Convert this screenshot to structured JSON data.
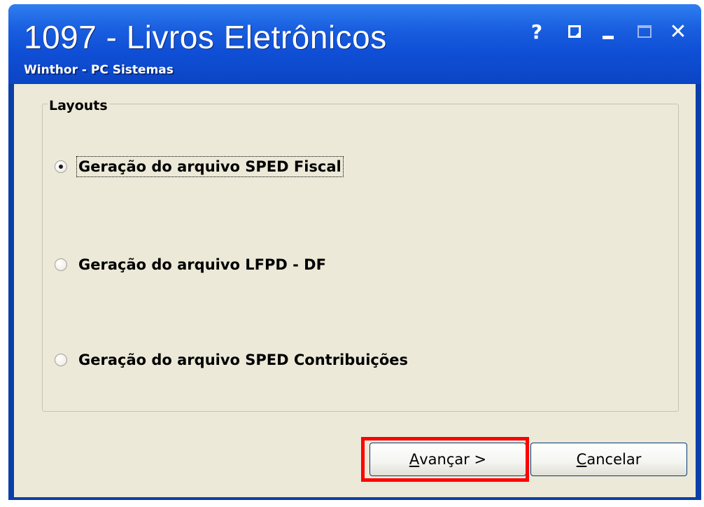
{
  "window": {
    "title": "1097 - Livros Eletrônicos",
    "subtitle": "Winthor - PC Sistemas",
    "controls": {
      "help": "?",
      "close": "✕"
    }
  },
  "layouts": {
    "group_label": "Layouts",
    "options": [
      {
        "label": "Geração do arquivo SPED Fiscal",
        "selected": true
      },
      {
        "label": "Geração do arquivo LFPD - DF",
        "selected": false
      },
      {
        "label": "Geração do arquivo SPED Contribuições",
        "selected": false
      }
    ]
  },
  "buttons": {
    "next_first": "A",
    "next_rest": "vançar >",
    "cancel_first": "C",
    "cancel_rest": "ancelar"
  },
  "colors": {
    "titlebar": "#0f4fd6",
    "client_bg": "#ece9d8",
    "highlight": "#ff0000"
  }
}
